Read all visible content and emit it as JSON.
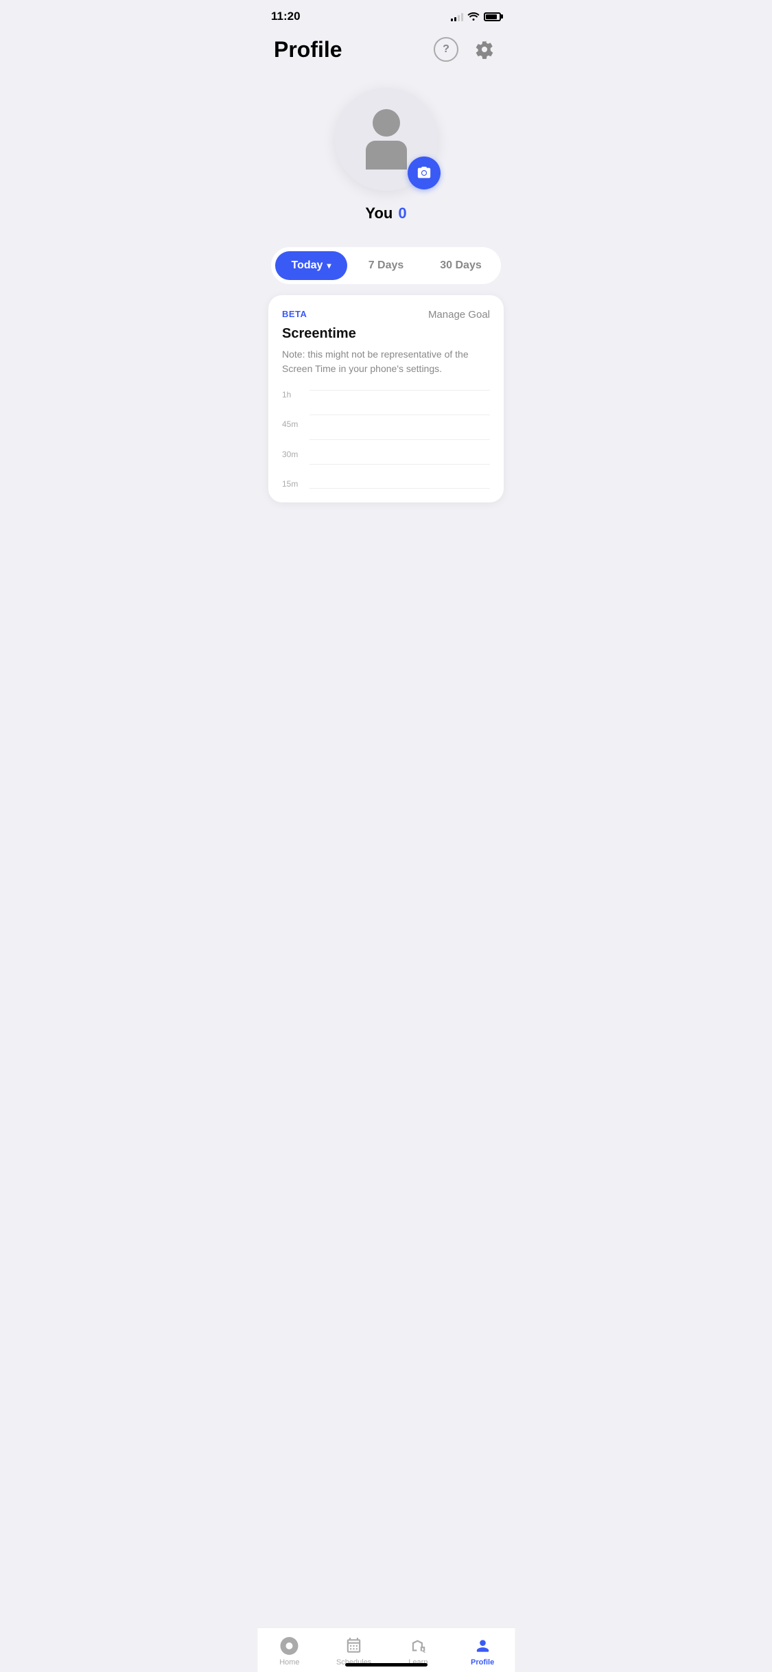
{
  "statusBar": {
    "time": "11:20"
  },
  "header": {
    "title": "Profile",
    "helpLabel": "?",
    "settingsLabel": "settings"
  },
  "avatar": {
    "userName": "You",
    "userScore": "0"
  },
  "timeFilter": {
    "options": [
      "Today",
      "7 Days",
      "30 Days"
    ],
    "activeIndex": 0,
    "chevron": "▾"
  },
  "screentime": {
    "beta": "BETA",
    "manageGoal": "Manage Goal",
    "title": "Screentime",
    "note": "Note: this might not be representative of the Screen Time in your phone's settings.",
    "chartLabels": [
      "1h",
      "45m",
      "30m",
      "15m"
    ]
  },
  "bottomNav": {
    "items": [
      {
        "label": "Home",
        "icon": "home",
        "active": false
      },
      {
        "label": "Schedules",
        "icon": "schedules",
        "active": false
      },
      {
        "label": "Learn",
        "icon": "learn",
        "active": false
      },
      {
        "label": "Profile",
        "icon": "profile",
        "active": true
      }
    ]
  }
}
